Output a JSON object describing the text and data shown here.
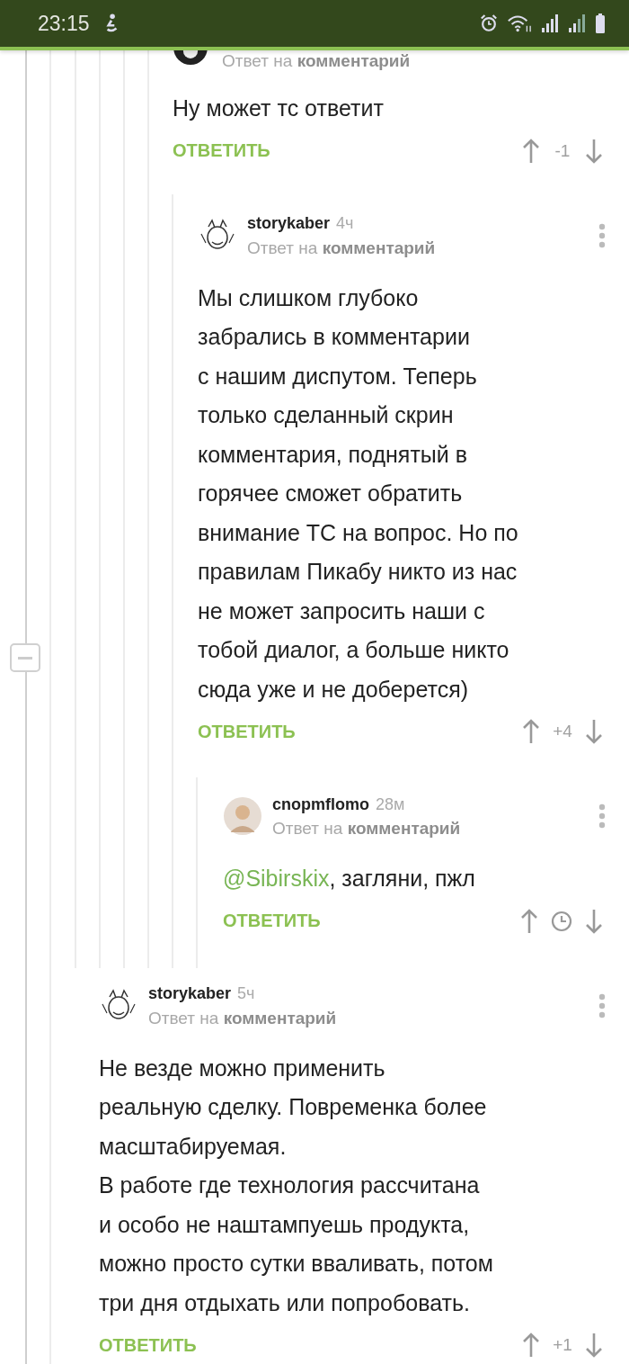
{
  "status_bar": {
    "time": "23:15"
  },
  "comments": [
    {
      "reply_label": "Ответ на **комментарий**",
      "text": "Ну может тс ответит",
      "reply_button": "ОТВЕТИТЬ",
      "rating": "-1",
      "rating_hidden": false,
      "children": [
        {
          "author": "storykaber",
          "age": "4ч",
          "reply_label": "Ответ на **комментарий**",
          "text": "Мы слишком глубоко\nзабрались в комментарии\nс нашим диспутом. Теперь\nтолько сделанный скрин\nкомментария, поднятый в\nгорячее сможет обратить\nвнимание ТС на вопрос. Но по\nправилам Пикабу никто из нас\nне может запросить наши с\nтобой диалог, а больше никто\nсюда уже и не доберется)",
          "reply_button": "ОТВЕТИТЬ",
          "rating": "+4",
          "rating_hidden": false,
          "children": [
            {
              "author": "cnopmflomo",
              "age": "28м",
              "reply_label": "Ответ на **комментарий**",
              "mention": "@Sibirskix",
              "text": ", загляни, пжл",
              "reply_button": "ОТВЕТИТЬ",
              "rating_hidden": true
            }
          ]
        }
      ]
    },
    {
      "author": "storykaber",
      "age": "5ч",
      "reply_label": "Ответ на **комментарий**",
      "text": "Не везде можно применить\nреальную сделку. Повременка более\nмасштабируемая.\nВ работе где технология рассчитана\nи особо не наштампуешь продукта,\nможно просто сутки вваливать, потом\nтри дня отдыхать или попробовать.",
      "reply_button": "ОТВЕТИТЬ",
      "rating": "+1",
      "rating_hidden": false
    }
  ]
}
